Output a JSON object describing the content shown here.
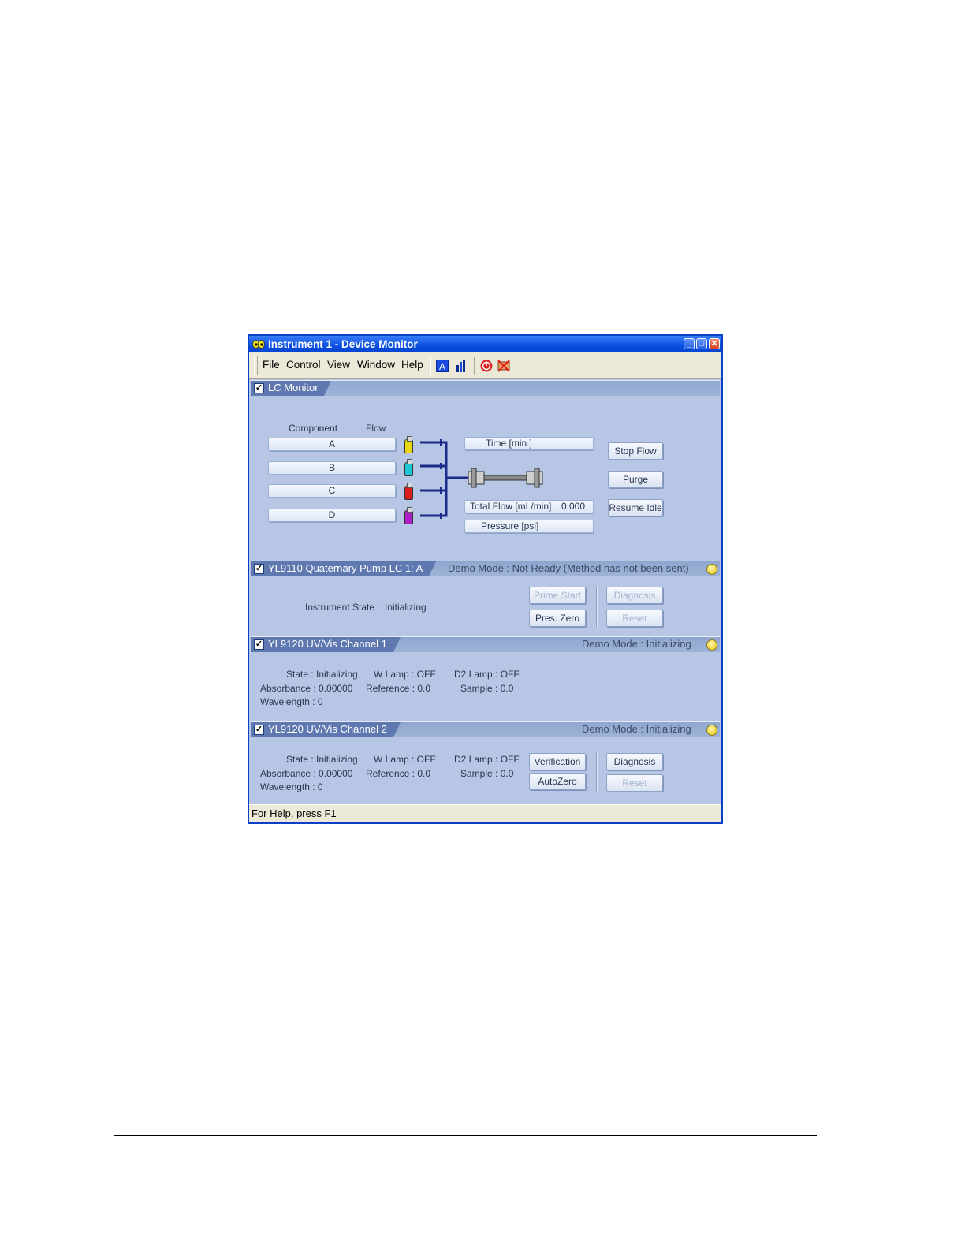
{
  "window": {
    "title": "Instrument 1 - Device Monitor",
    "controls": {
      "minimize": "_",
      "maximize": "□",
      "close": "✕"
    }
  },
  "menubar": {
    "items": [
      "File",
      "Control",
      "View",
      "Window",
      "Help"
    ],
    "tools": [
      "a-icon",
      "chart-icon",
      "stop-icon",
      "network-error-icon"
    ]
  },
  "lc_monitor": {
    "header": "LC Monitor",
    "component_label": "Component",
    "flow_label": "Flow",
    "components": [
      "A",
      "B",
      "C",
      "D"
    ],
    "bottle_colors": [
      "#e8d80a",
      "#1fc7d4",
      "#d81e1e",
      "#b01ec8"
    ],
    "time_label": "Time [min.]",
    "total_flow_label": "Total Flow [mL/min]",
    "total_flow_value": "0.000",
    "pressure_label": "Pressure [psi]",
    "buttons": {
      "stop_flow": "Stop Flow",
      "purge": "Purge",
      "resume_idle": "Resume Idle"
    }
  },
  "pump": {
    "header": "YL9110 Quaternary Pump  LC 1: A",
    "status": "Demo Mode : Not Ready (Method has not been sent)",
    "instrument_state_label": "Instrument State :",
    "instrument_state_value": "Initializing",
    "buttons": {
      "prime_start": "Prime Start",
      "pres_zero": "Pres. Zero",
      "diagnosis": "Diagnosis",
      "reset": "Reset"
    }
  },
  "channel1": {
    "header": "YL9120 UV/Vis  Channel 1",
    "status": "Demo Mode : Initializing",
    "state": "State : Initializing",
    "absorbance": "Absorbance : 0.00000",
    "wavelength": "Wavelength : 0",
    "w_lamp": "W Lamp : OFF",
    "reference": "Reference : 0.0",
    "d2_lamp": "D2 Lamp : OFF",
    "sample": "Sample : 0.0"
  },
  "channel2": {
    "header": "YL9120 UV/Vis  Channel 2",
    "status": "Demo Mode : Initializing",
    "state": "State : Initializing",
    "absorbance": "Absorbance : 0.00000",
    "wavelength": "Wavelength : 0",
    "w_lamp": "W Lamp : OFF",
    "reference": "Reference : 0.0",
    "d2_lamp": "D2 Lamp : OFF",
    "sample": "Sample : 0.0",
    "buttons": {
      "verification": "Verification",
      "autozero": "AutoZero",
      "diagnosis": "Diagnosis",
      "reset": "Reset"
    }
  },
  "statusbar": {
    "text": "For Help, press F1"
  }
}
